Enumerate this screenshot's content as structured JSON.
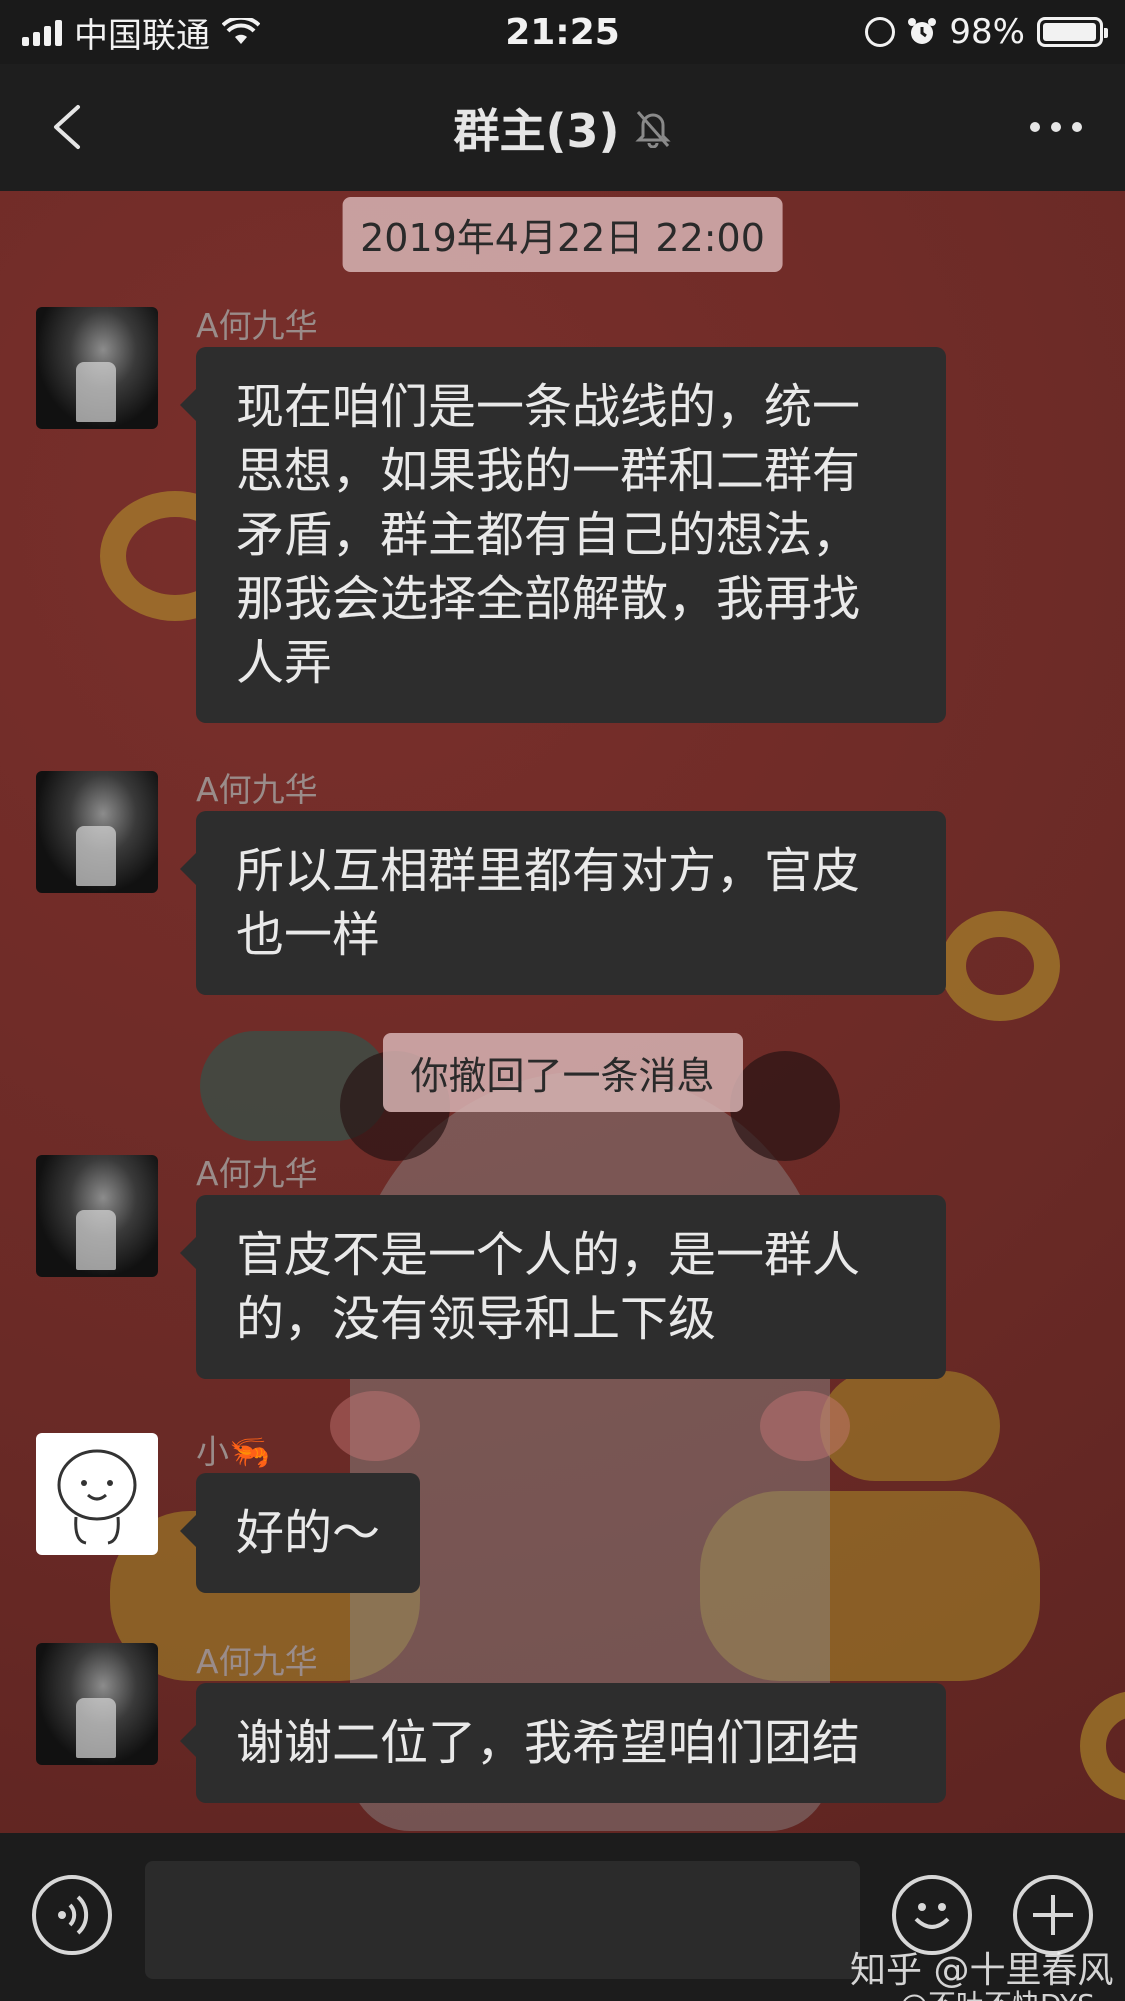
{
  "status_bar": {
    "carrier": "中国联通",
    "time": "21:25",
    "battery": "98%",
    "battery_level": 0.98
  },
  "header": {
    "title": "群主(3)"
  },
  "messages": [
    {
      "type": "timestamp",
      "text": "2019年4月22日 22:00"
    },
    {
      "type": "message",
      "sender": "A何九华",
      "text": "现在咱们是一条战线的，统一思想，如果我的一群和二群有矛盾，群主都有自己的想法，那我会选择全部解散，我再找人弄"
    },
    {
      "type": "message",
      "sender": "A何九华",
      "text": "所以互相群里都有对方，官皮也一样"
    },
    {
      "type": "system",
      "text": "你撤回了一条消息"
    },
    {
      "type": "message",
      "sender": "A何九华",
      "text": "官皮不是一个人的，是一群人的，没有领导和上下级"
    },
    {
      "type": "message",
      "sender": "小🦐",
      "text": "好的～"
    },
    {
      "type": "message",
      "sender": "A何九华",
      "text": "谢谢二位了，我希望咱们团结"
    }
  ],
  "input_bar": {
    "input_value": ""
  },
  "watermarks": {
    "zhihu": "知乎 @十里春风",
    "weibo": "@不吐不快DYS"
  },
  "colors": {
    "chat_background": "#6a2a26",
    "bubble": "#2d2d2d",
    "timestamp_pill": "#d7b4b4",
    "bar": "#1c1c1c"
  },
  "icons": {
    "back": "chevron-left-icon",
    "mute": "bell-slash-icon",
    "more": "ellipsis-icon",
    "voice": "voice-icon",
    "emoji": "smiley-icon",
    "plus": "plus-icon"
  }
}
